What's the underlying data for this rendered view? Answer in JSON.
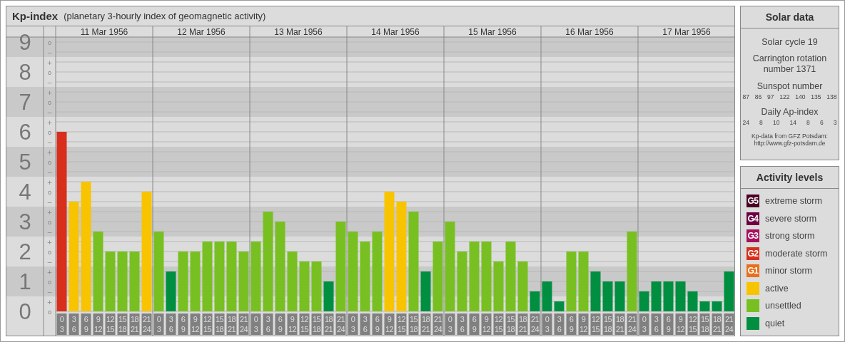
{
  "main_panel": {
    "title": "Kp-index",
    "subtitle": "(planetary 3-hourly index of geomagnetic activity)",
    "chart_data": {
      "type": "bar",
      "ylim": [
        0,
        9
      ],
      "grid": true,
      "yticks": [
        0,
        1,
        2,
        3,
        4,
        5,
        6,
        7,
        8,
        9
      ],
      "annotations": [
        {
          "text": "11 Mar 1956"
        },
        {
          "text": "12 Mar 1956"
        },
        {
          "text": "13 Mar 1956"
        },
        {
          "text": "14 Mar 1956"
        },
        {
          "text": "15 Mar 1956"
        },
        {
          "text": "16 Mar 1956"
        },
        {
          "text": "17 Mar 1956"
        }
      ],
      "categories": [
        "0 3",
        "3 6",
        "6 9",
        "9 12",
        "12 15",
        "15 18",
        "18 21",
        "21 24",
        "0 3",
        "3 6",
        "6 9",
        "9 12",
        "12 15",
        "15 18",
        "18 21",
        "21 24",
        "0 3",
        "3 6",
        "6 9",
        "9 12",
        "12 15",
        "15 18",
        "18 21",
        "21 24",
        "0 3",
        "3 6",
        "6 9",
        "9 12",
        "12 15",
        "15 18",
        "18 21",
        "21 24",
        "0 3",
        "3 6",
        "6 9",
        "9 12",
        "12 15",
        "15 18",
        "18 21",
        "21 24",
        "0 3",
        "3 6",
        "6 9",
        "9 12",
        "12 15",
        "15 18",
        "18 21",
        "21 24",
        "0 3",
        "3 6",
        "6 9",
        "9 12",
        "12 15",
        "15 18",
        "18 21",
        "21 24"
      ],
      "values": [
        6,
        3.667,
        4.333,
        2.667,
        2,
        2,
        2,
        4,
        2.667,
        1.333,
        2,
        2,
        2.333,
        2.333,
        2.333,
        2,
        2.333,
        3.333,
        3,
        2,
        1.667,
        1.667,
        1,
        3,
        2.667,
        2.333,
        2.667,
        4,
        3.667,
        3.333,
        1.333,
        2.333,
        3,
        2,
        2.333,
        2.333,
        1.667,
        2.333,
        1.667,
        0.667,
        1,
        0.333,
        2,
        2,
        1.333,
        1,
        1,
        2.667,
        0.667,
        1,
        1,
        1,
        0.667,
        0.333,
        0.333,
        1.333
      ]
    },
    "scale_marks": [
      "o",
      "−",
      "+",
      "o",
      "−",
      "+",
      "o",
      "−",
      "+",
      "o",
      "−",
      "+",
      "o",
      "−",
      "+",
      "o",
      "−",
      "+",
      "o",
      "−",
      "+",
      "o",
      "−",
      "+",
      "o",
      "−",
      "+",
      "o"
    ]
  },
  "solar_data": {
    "title": "Solar data",
    "solar_cycle": "Solar cycle 19",
    "carrington": "Carrington rotation number 1371",
    "sunspot_title": "Sunspot number",
    "sunspot_numbers": [
      "87",
      "86",
      "97",
      "122",
      "140",
      "135",
      "138"
    ],
    "ap_title": "Daily Ap-index",
    "ap_values": [
      "24",
      "8",
      "10",
      "14",
      "8",
      "6",
      "3"
    ],
    "source": "Kp-data from GFZ Potsdam:",
    "source_url": "http://www.gfz-potsdam.de"
  },
  "activity_levels": {
    "title": "Activity levels",
    "items": [
      {
        "badge": "G5",
        "label": "extreme storm",
        "color": "#4a0024"
      },
      {
        "badge": "G4",
        "label": "severe storm",
        "color": "#6e0042"
      },
      {
        "badge": "G3",
        "label": "strong storm",
        "color": "#a8105e"
      },
      {
        "badge": "G2",
        "label": "moderate storm",
        "color": "#d82e1c"
      },
      {
        "badge": "G1",
        "label": "minor storm",
        "color": "#e8701a"
      },
      {
        "label": "active",
        "color": "#f8c400"
      },
      {
        "label": "unsettled",
        "color": "#78c022"
      },
      {
        "label": "quiet",
        "color": "#008f40"
      }
    ]
  }
}
